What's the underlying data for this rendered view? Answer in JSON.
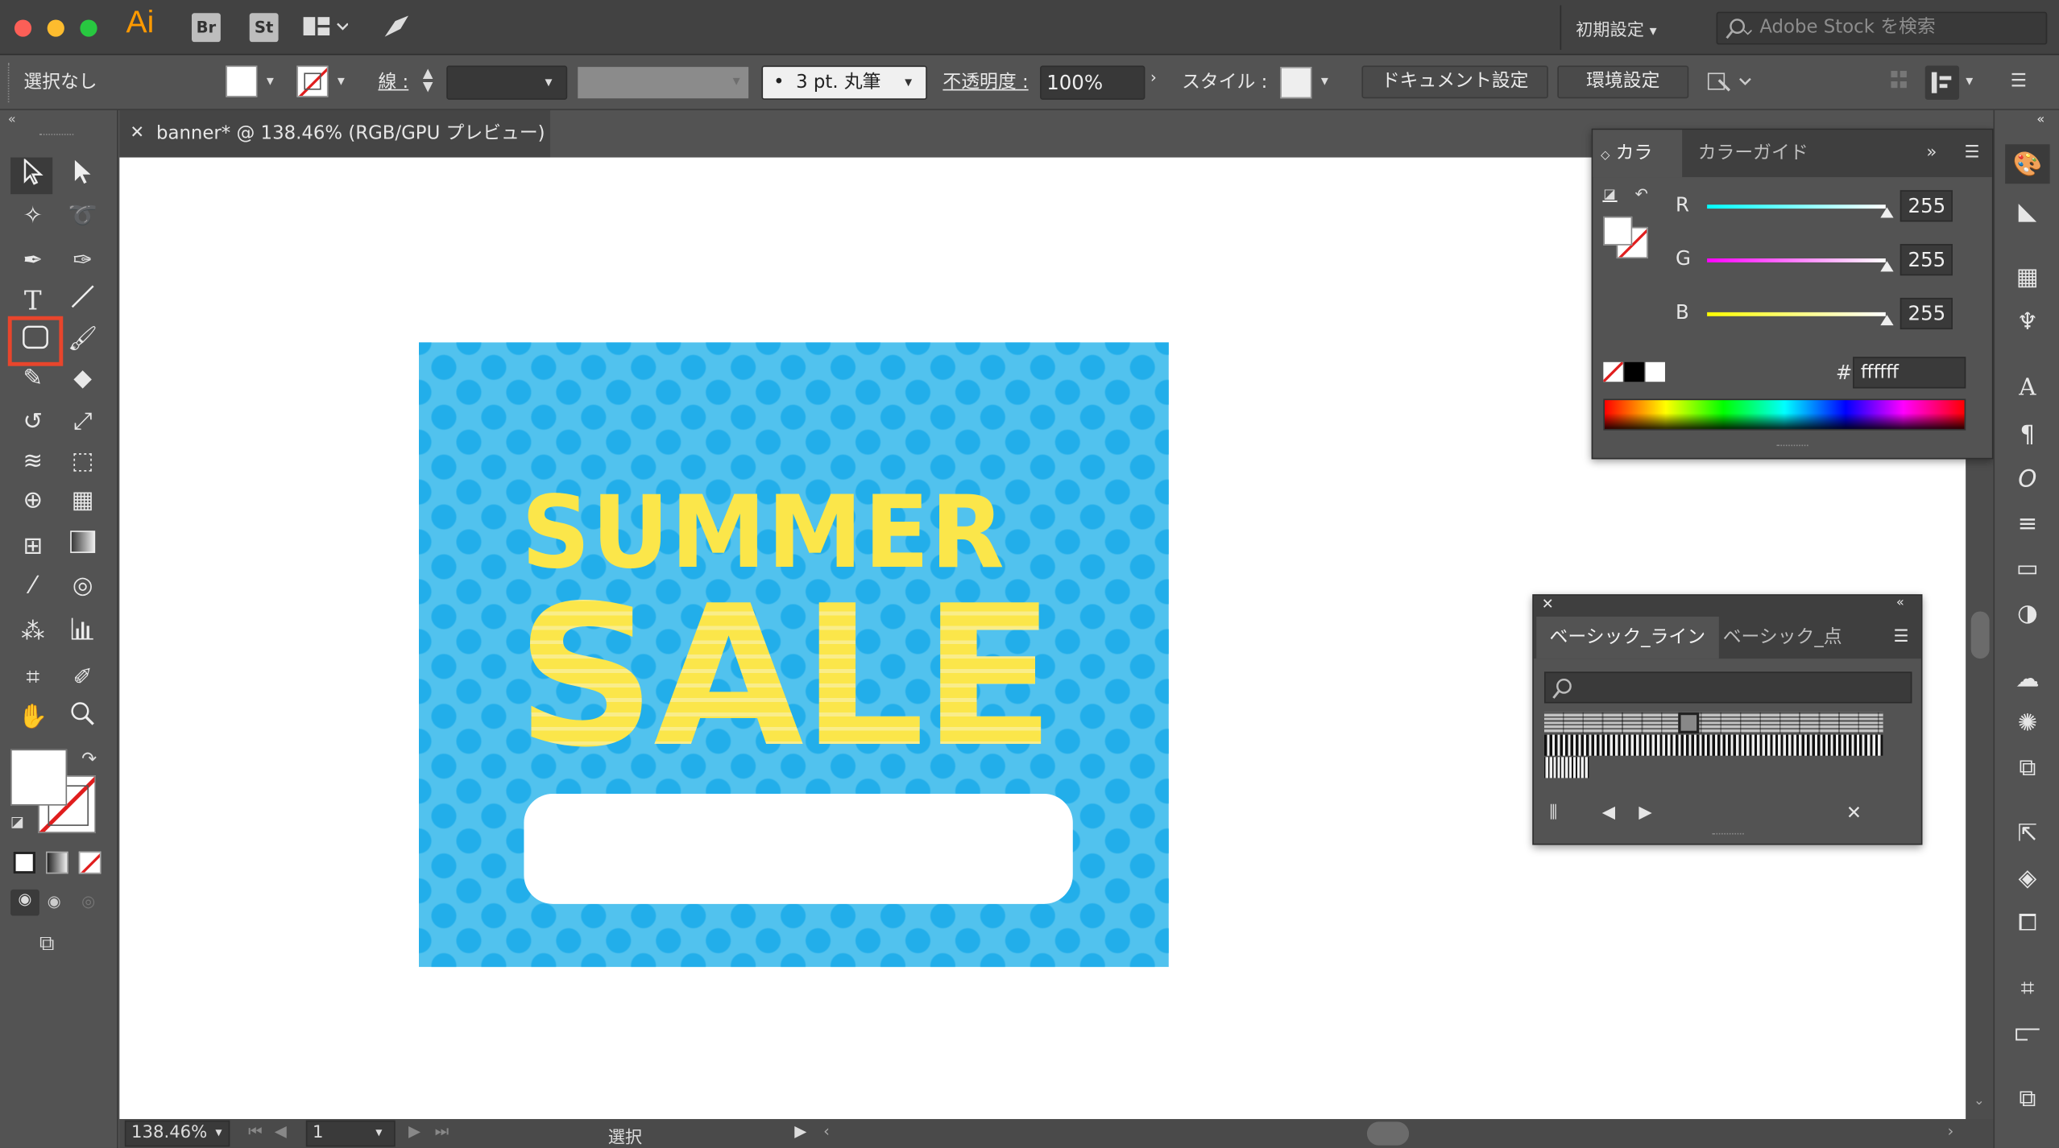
{
  "app": {
    "logo": "Ai",
    "apps": [
      "Br",
      "St"
    ],
    "workspace": "初期設定",
    "stock_placeholder": "Adobe Stock を検索"
  },
  "control": {
    "selection": "選択なし",
    "stroke_label": "線 :",
    "brush": "3 pt. 丸筆",
    "opacity_label": "不透明度 :",
    "opacity_value": "100%",
    "style_label": "スタイル :",
    "doc_settings": "ドキュメント設定",
    "prefs": "環境設定"
  },
  "document": {
    "tab_title": "banner* @ 138.46% (RGB/GPU プレビュー)"
  },
  "artwork": {
    "line1": "SUMMER",
    "line2": "SALE"
  },
  "color_panel": {
    "tabs": [
      "カラー",
      "カラーガイド"
    ],
    "channels": [
      {
        "label": "R",
        "value": "255"
      },
      {
        "label": "G",
        "value": "255"
      },
      {
        "label": "B",
        "value": "255"
      }
    ],
    "hash": "#",
    "hex": "ffffff"
  },
  "pattern_panel": {
    "tabs": [
      "ベーシック_ライン",
      "ベーシック_点"
    ]
  },
  "status": {
    "zoom": "138.46%",
    "artboard": "1",
    "tool": "選択"
  },
  "colors": {
    "accent": "#e8452c",
    "banner_bg": "#51c2ee",
    "dots": "#22aeea",
    "text_yellow": "#fbe64a"
  }
}
